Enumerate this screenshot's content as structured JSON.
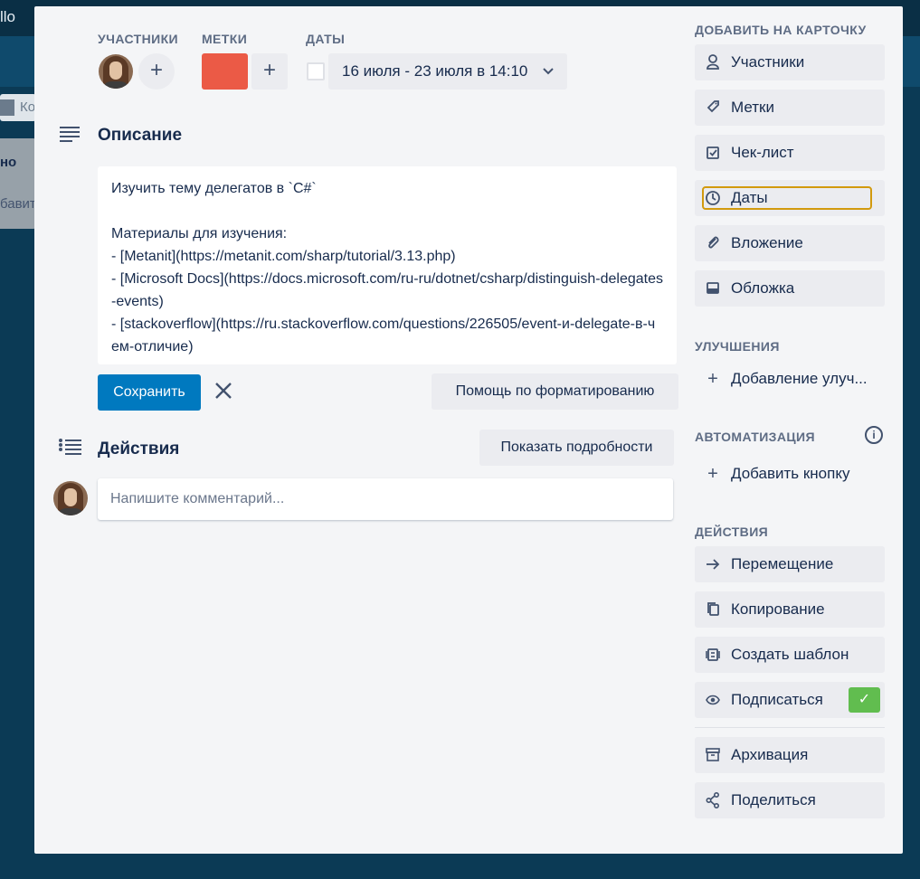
{
  "background": {
    "app_logo": "llo",
    "board_name": "Ко",
    "list_title": "но",
    "list_add": "бавит"
  },
  "members_section": {
    "label": "УЧАСТНИКИ",
    "add": "+"
  },
  "labels_section": {
    "label": "МЕТКИ",
    "label_color": "#eb5a46",
    "add": "+"
  },
  "dates_section": {
    "label": "ДАТЫ",
    "value": "16 июля - 23 июля в 14:10",
    "chevron": "⌄"
  },
  "description": {
    "title": "Описание",
    "text": "Изучить тему делегатов в `C#`\n\nМатериалы для изучения:\n- [Metanit](https://metanit.com/sharp/tutorial/3.13.php)\n- [Microsoft Docs](https://docs.microsoft.com/ru-ru/dotnet/csharp/distinguish-delegates-events)\n- [stackoverflow](https://ru.stackoverflow.com/questions/226505/event-и-delegate-в-чем-отличие)",
    "save": "Сохранить",
    "close": "✕",
    "formatting_help": "Помощь по форматированию"
  },
  "activity": {
    "title": "Действия",
    "show_details": "Показать подробности",
    "comment_placeholder": "Напишите комментарий..."
  },
  "sidebar": {
    "add_to_card": {
      "heading": "ДОБАВИТЬ НА КАРТОЧКУ",
      "items": [
        {
          "label": "Участники",
          "icon": "person-icon"
        },
        {
          "label": "Метки",
          "icon": "tag-icon"
        },
        {
          "label": "Чек-лист",
          "icon": "checklist-icon"
        },
        {
          "label": "Даты",
          "icon": "clock-icon"
        },
        {
          "label": "Вложение",
          "icon": "paperclip-icon"
        },
        {
          "label": "Обложка",
          "icon": "cover-icon"
        }
      ]
    },
    "powerups": {
      "heading": "УЛУЧШЕНИЯ",
      "add_label": "Добавление улуч..."
    },
    "automation": {
      "heading": "АВТОМАТИЗАЦИЯ",
      "add_label": "Добавить кнопку",
      "info": "i"
    },
    "actions": {
      "heading": "ДЕЙСТВИЯ",
      "items": [
        {
          "label": "Перемещение",
          "icon": "arrow-right-icon"
        },
        {
          "label": "Копирование",
          "icon": "copy-icon"
        },
        {
          "label": "Создать шаблон",
          "icon": "template-icon"
        },
        {
          "label": "Подписаться",
          "icon": "eye-icon"
        },
        {
          "label": "Архивация",
          "icon": "archive-icon"
        },
        {
          "label": "Поделиться",
          "icon": "share-icon"
        }
      ],
      "subscribed_check": "✓"
    }
  }
}
